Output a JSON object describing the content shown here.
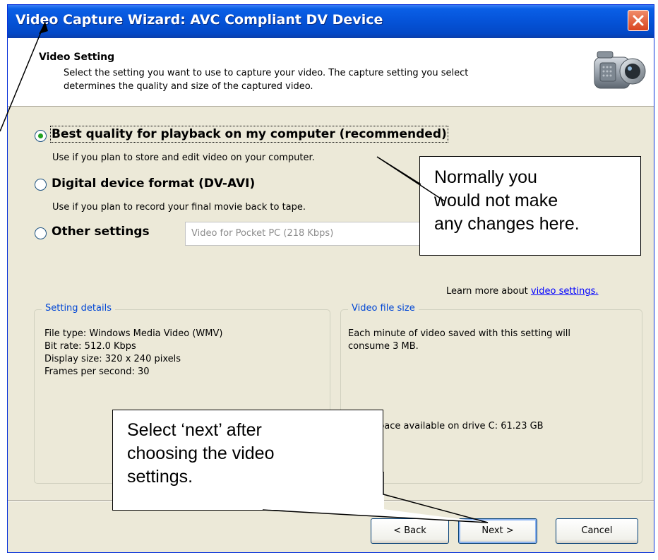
{
  "window": {
    "title": "Video Capture Wizard: AVC Compliant DV Device",
    "icons": {
      "close": "close-icon",
      "camera": "camcorder-icon"
    }
  },
  "header": {
    "title": "Video Setting",
    "description_line1": "Select the setting you want to use to capture your video. The capture setting you select",
    "description_line2": "determines the quality and size of the captured video."
  },
  "options": [
    {
      "label": "Best quality for playback on my computer (recommended)",
      "description": "Use if you plan to store and edit video on your computer.",
      "selected": true
    },
    {
      "label": "Digital device format (DV-AVI)",
      "description": "Use if you plan to record your final movie back to tape.",
      "selected": false
    },
    {
      "label": "Other settings",
      "selected": false
    }
  ],
  "other_settings_select": {
    "value": "Video for Pocket PC (218 Kbps)"
  },
  "learn_more": {
    "prefix": "Learn more about",
    "link": "video settings."
  },
  "setting_details": {
    "legend": "Setting details",
    "lines": [
      "File type: Windows Media Video (WMV)",
      "Bit rate: 512.0 Kbps",
      "Display size: 320 x 240 pixels",
      "Frames per second: 30"
    ]
  },
  "video_file_size": {
    "legend": "Video file size",
    "line1": "Each minute of video saved with this setting  will",
    "line2": "consume 3 MB.",
    "space_text": "pace available on drive C: 61.23 GB"
  },
  "buttons": {
    "back": "< Back",
    "next": "Next >",
    "cancel": "Cancel"
  },
  "callouts": {
    "top": [
      "Normally you",
      "would not make",
      "any changes here."
    ],
    "bottom": [
      "Select ‘next’ after",
      "choosing the video",
      "settings."
    ]
  },
  "colors": {
    "title_bar": "#0553d8",
    "dialog_bg": "#ece9d8",
    "link": "#0000ff",
    "group_legend": "#0046d5",
    "close": "#d94420"
  }
}
